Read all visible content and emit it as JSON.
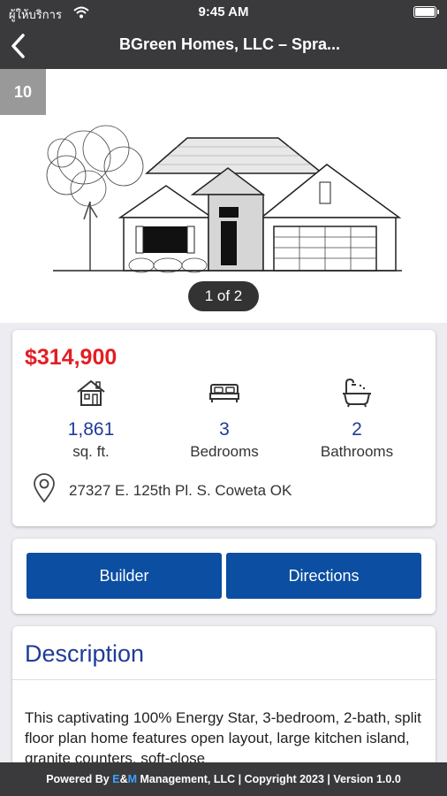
{
  "status_bar": {
    "carrier": "ผู้ให้บริการ",
    "time": "9:45 AM"
  },
  "header": {
    "title": "BGreen Homes, LLC  – Spra..."
  },
  "photo": {
    "photo_count_badge": "10",
    "pager": "1 of 2"
  },
  "listing": {
    "price": "$314,900",
    "stats": [
      {
        "icon": "house-icon",
        "value": "1,861",
        "label": "sq. ft."
      },
      {
        "icon": "bed-icon",
        "value": "3",
        "label": "Bedrooms"
      },
      {
        "icon": "bathtub-icon",
        "value": "2",
        "label": "Bathrooms"
      }
    ],
    "address": "27327 E. 125th Pl. S. Coweta OK"
  },
  "actions": {
    "builder": "Builder",
    "directions": "Directions"
  },
  "description": {
    "title": "Description",
    "body": "This captivating 100% Energy Star, 3-bedroom, 2-bath, split floor plan home features open layout, large kitchen island, granite counters, soft-close"
  },
  "footer": {
    "prefix": "Powered By ",
    "brand_e": "E",
    "brand_amp": "&",
    "brand_m": "M",
    "suffix": " Management, LLC | Copyright 2023 | Version 1.0.0"
  },
  "colors": {
    "header_bg": "#3a3a3c",
    "price": "#e31e24",
    "accent_blue": "#1f3c96",
    "button": "#0b4ea2"
  }
}
